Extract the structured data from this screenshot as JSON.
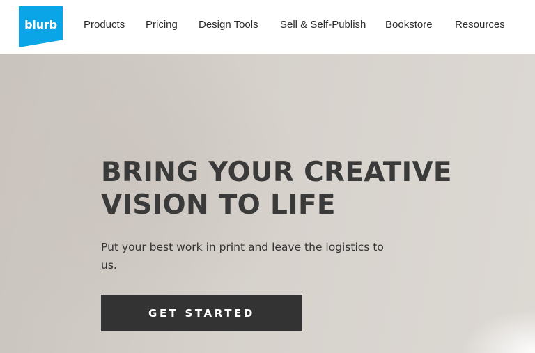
{
  "nav": {
    "logo_text": "blurb",
    "items": [
      {
        "label": "Products"
      },
      {
        "label": "Pricing"
      },
      {
        "label": "Design Tools"
      },
      {
        "label": "Sell & Self-Publish"
      },
      {
        "label": "Bookstore"
      },
      {
        "label": "Resources"
      }
    ]
  },
  "hero": {
    "headline_line1": "BRING YOUR CREATIVE",
    "headline_line2": "VISION TO LIFE",
    "subtitle": "Put your best work in print and leave the logistics to us.",
    "cta_label": "GET STARTED"
  },
  "colors": {
    "brand_blue": "#0aa5e6",
    "cta_background": "#333333",
    "headline_text": "#3a3a3a"
  }
}
